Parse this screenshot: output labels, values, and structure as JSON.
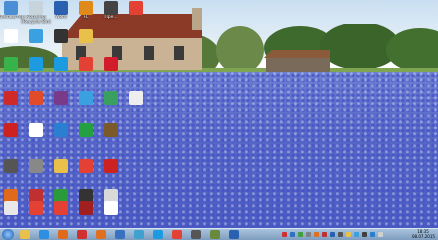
{
  "desktop": {
    "wallpaper": "bluebonnet-field-with-stone-house",
    "icons_row1": [
      {
        "label": "Компьютер",
        "icon": "computer-icon",
        "color": "#4a8fd6"
      },
      {
        "label": "Корзина (Recycle Bin)",
        "icon": "recycle-bin-icon",
        "color": "#c8d4dc"
      },
      {
        "label": "Word",
        "icon": "word-icon",
        "color": "#2b5fb0"
      },
      {
        "label": "FL",
        "icon": "fl-studio-icon",
        "color": "#e08a1c"
      },
      {
        "label": "Пре...",
        "icon": "app-icon",
        "color": "#444"
      },
      {
        "label": "",
        "icon": "chrome-icon",
        "color": "#e34133"
      }
    ],
    "icons_row2": [
      {
        "label": "",
        "icon": "document-icon",
        "color": "#ffffff"
      },
      {
        "label": "",
        "icon": "browser-icon",
        "color": "#3aa0e0"
      },
      {
        "label": "",
        "icon": "media-icon",
        "color": "#333"
      },
      {
        "label": "",
        "icon": "folder-icon",
        "color": "#e8c04a"
      }
    ],
    "icons_row3": [
      {
        "label": "",
        "icon": "whatsapp-icon",
        "color": "#37b34a"
      },
      {
        "label": "",
        "icon": "skype-icon",
        "color": "#1d9be0"
      },
      {
        "label": "",
        "icon": "skype-icon",
        "color": "#1d9be0"
      },
      {
        "label": "",
        "icon": "chrome-icon",
        "color": "#e34133"
      },
      {
        "label": "",
        "icon": "opera-icon",
        "color": "#d21c2b"
      }
    ],
    "icons_row4": [
      {
        "label": "",
        "icon": "pdf-icon",
        "color": "#cf2a2a"
      },
      {
        "label": "",
        "icon": "app-icon",
        "color": "#e04b2a"
      },
      {
        "label": "",
        "icon": "winrar-icon",
        "color": "#7a3a8a"
      },
      {
        "label": "",
        "icon": "browser-icon",
        "color": "#3aa0e0"
      },
      {
        "label": "",
        "icon": "globe-icon",
        "color": "#3aa060"
      },
      {
        "label": "",
        "icon": "hat-icon",
        "color": "#eeeeee"
      }
    ],
    "icons_row5": [
      {
        "label": "",
        "icon": "app-icon",
        "color": "#cc2222"
      },
      {
        "label": "",
        "icon": "flag-icon",
        "color": "#ffffff"
      },
      {
        "label": "",
        "icon": "network-icon",
        "color": "#2a7fd0"
      },
      {
        "label": "",
        "icon": "app-icon",
        "color": "#24a040"
      },
      {
        "label": "",
        "icon": "minecraft-icon",
        "color": "#7a5a2a"
      }
    ],
    "icons_row6": [
      {
        "label": "",
        "icon": "app-icon",
        "color": "#555555"
      },
      {
        "label": "",
        "icon": "app-icon",
        "color": "#888888"
      },
      {
        "label": "",
        "icon": "folder-icon",
        "color": "#e8c04a"
      },
      {
        "label": "",
        "icon": "chrome-icon",
        "color": "#e34133"
      },
      {
        "label": "",
        "icon": "app-icon",
        "color": "#cc2222"
      }
    ],
    "icons_row7": [
      {
        "label": "",
        "icon": "app-icon",
        "color": "#e06a1c"
      },
      {
        "label": "",
        "icon": "app-icon",
        "color": "#c03030"
      },
      {
        "label": "",
        "icon": "app-icon",
        "color": "#2a9a3a"
      },
      {
        "label": "",
        "icon": "app-icon",
        "color": "#333333"
      },
      {
        "label": "",
        "icon": "app-icon",
        "color": "#d9d9d9"
      }
    ],
    "icons_row8": [
      {
        "label": "",
        "icon": "document-icon",
        "color": "#e8e8e8"
      },
      {
        "label": "",
        "icon": "chrome-icon",
        "color": "#e34133"
      },
      {
        "label": "",
        "icon": "chrome-icon",
        "color": "#e34133"
      },
      {
        "label": "",
        "icon": "app-icon",
        "color": "#a02020"
      },
      {
        "label": "",
        "icon": "document-icon",
        "color": "#ffffff"
      }
    ]
  },
  "taskbar": {
    "start_icon": "windows-start-icon",
    "pinned": [
      {
        "icon": "explorer-icon",
        "color": "#e8c04a"
      },
      {
        "icon": "ie-icon",
        "color": "#2d8fe0"
      },
      {
        "icon": "media-player-icon",
        "color": "#e06a1c"
      },
      {
        "icon": "app-icon",
        "color": "#d03030"
      },
      {
        "icon": "firefox-icon",
        "color": "#e07020"
      },
      {
        "icon": "app-icon",
        "color": "#3a70c0"
      },
      {
        "icon": "app-icon",
        "color": "#40a0d0"
      },
      {
        "icon": "skype-icon",
        "color": "#1d9be0"
      },
      {
        "icon": "chrome-icon",
        "color": "#e34133"
      },
      {
        "icon": "app-icon",
        "color": "#555555"
      },
      {
        "icon": "minecraft-icon",
        "color": "#6a8a3a"
      },
      {
        "icon": "app-icon",
        "color": "#2a60b0"
      }
    ],
    "clock_time": "18:35",
    "clock_date": "08.07.2015"
  }
}
